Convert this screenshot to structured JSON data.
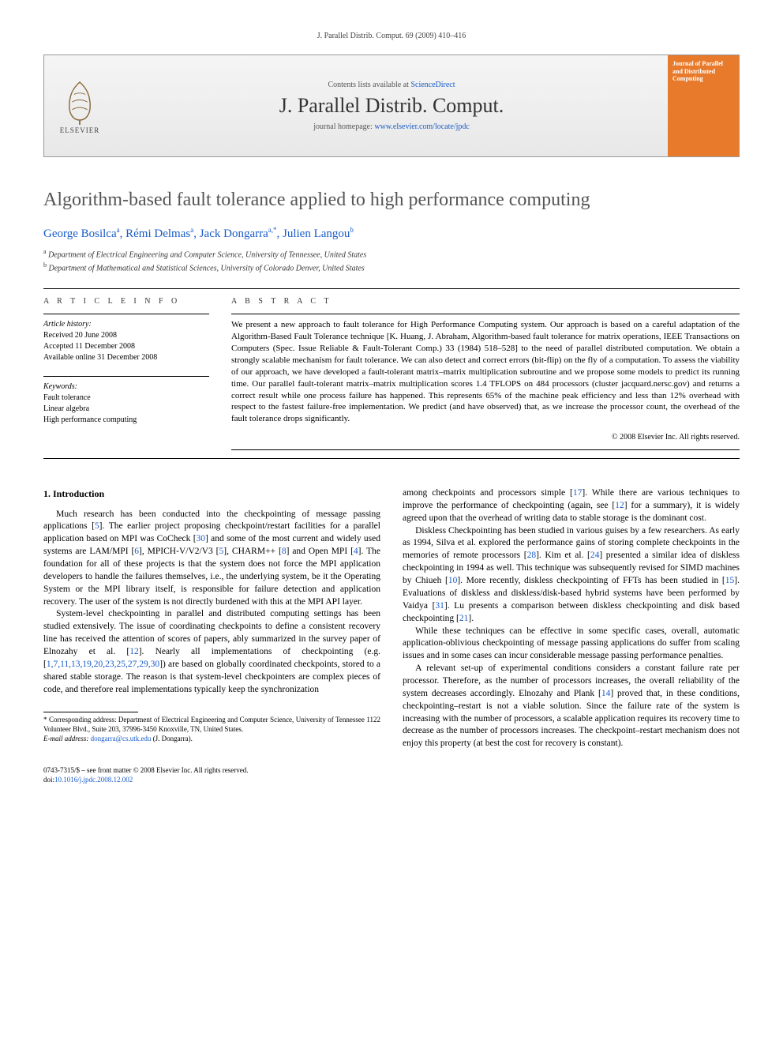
{
  "running_head": "J. Parallel Distrib. Comput. 69 (2009) 410–416",
  "banner": {
    "elsevier_label": "ELSEVIER",
    "contents_prefix": "Contents lists available at ",
    "contents_link": "ScienceDirect",
    "journal_name": "J. Parallel Distrib. Comput.",
    "homepage_prefix": "journal homepage: ",
    "homepage_link": "www.elsevier.com/locate/jpdc",
    "cover_title": "Journal of Parallel and Distributed Computing"
  },
  "title": "Algorithm-based fault tolerance applied to high performance computing",
  "authors": [
    {
      "name": "George Bosilca",
      "mark": "a"
    },
    {
      "name": "Rémi Delmas",
      "mark": "a"
    },
    {
      "name": "Jack Dongarra",
      "mark": "a,*"
    },
    {
      "name": "Julien Langou",
      "mark": "b"
    }
  ],
  "affiliations": [
    {
      "mark": "a",
      "text": "Department of Electrical Engineering and Computer Science, University of Tennessee, United States"
    },
    {
      "mark": "b",
      "text": "Department of Mathematical and Statistical Sciences, University of Colorado Denver, United States"
    }
  ],
  "info": {
    "heading": "A R T I C L E   I N F O",
    "history_label": "Article history:",
    "history": [
      "Received 20 June 2008",
      "Accepted 11 December 2008",
      "Available online 31 December 2008"
    ],
    "keywords_label": "Keywords:",
    "keywords": [
      "Fault tolerance",
      "Linear algebra",
      "High performance computing"
    ]
  },
  "abstract": {
    "heading": "A B S T R A C T",
    "text": "We present a new approach to fault tolerance for High Performance Computing system. Our approach is based on a careful adaptation of the Algorithm-Based Fault Tolerance technique [K. Huang, J. Abraham, Algorithm-based fault tolerance for matrix operations, IEEE Transactions on Computers (Spec. Issue Reliable & Fault-Tolerant Comp.) 33 (1984) 518–528] to the need of parallel distributed computation. We obtain a strongly scalable mechanism for fault tolerance. We can also detect and correct errors (bit-flip) on the fly of a computation. To assess the viability of our approach, we have developed a fault-tolerant matrix–matrix multiplication subroutine and we propose some models to predict its running time. Our parallel fault-tolerant matrix–matrix multiplication scores 1.4 TFLOPS on 484 processors (cluster jacquard.nersc.gov) and returns a correct result while one process failure has happened. This represents 65% of the machine peak efficiency and less than 12% overhead with respect to the fastest failure-free implementation. We predict (and have observed) that, as we increase the processor count, the overhead of the fault tolerance drops significantly.",
    "copyright": "© 2008 Elsevier Inc. All rights reserved."
  },
  "section1": {
    "heading": "1. Introduction",
    "p1a": "Much research has been conducted into the checkpointing of message passing applications [",
    "p1b": "]. The earlier project proposing checkpoint/restart facilities for a parallel application based on MPI was CoCheck [",
    "p1c": "] and some of the most current and widely used systems are LAM/MPI [",
    "p1d": "], MPICH-V/V2/V3 [",
    "p1e": "], CHARM++ [",
    "p1f": "] and Open MPI [",
    "p1g": "]. The foundation for all of these projects is that the system does not force the MPI application developers to handle the failures themselves, i.e., the underlying system, be it the Operating System or the MPI library itself, is responsible for failure detection and application recovery. The user of the system is not directly burdened with this at the MPI API layer.",
    "p2a": "System-level checkpointing in parallel and distributed computing settings has been studied extensively. The issue of coordinating checkpoints to define a consistent recovery line has received the attention of scores of papers, ably summarized in the survey paper of Elnozahy et al. [",
    "p2b": "]. Nearly all implementations of checkpointing (e.g. [",
    "p2c": "]) are based on globally coordinated checkpoints, stored to a shared stable storage. The reason is that system-level checkpointers are complex pieces of code, and therefore real implementations typically keep the synchronization",
    "p3a": "among checkpoints and processors simple [",
    "p3b": "]. While there are various techniques to improve the performance of checkpointing (again, see [",
    "p3c": "] for a summary), it is widely agreed upon that the overhead of writing data to stable storage is the dominant cost.",
    "p4a": "Diskless Checkpointing has been studied in various guises by a few researchers. As early as 1994, Silva et al. explored the performance gains of storing complete checkpoints in the memories of remote processors [",
    "p4b": "]. Kim et al. [",
    "p4c": "] presented a similar idea of diskless checkpointing in 1994 as well. This technique was subsequently revised for SIMD machines by Chiueh [",
    "p4d": "]. More recently, diskless checkpointing of FFTs has been studied in [",
    "p4e": "]. Evaluations of diskless and diskless/disk-based hybrid systems have been performed by Vaidya [",
    "p4f": "]. Lu presents a comparison between diskless checkpointing and disk based checkpointing [",
    "p4g": "].",
    "p5": "While these techniques can be effective in some specific cases, overall, automatic application-oblivious checkpointing of message passing applications do suffer from scaling issues and in some cases can incur considerable message passing performance penalties.",
    "p6a": "A relevant set-up of experimental conditions considers a constant failure rate per processor. Therefore, as the number of processors increases, the overall reliability of the system decreases accordingly. Elnozahy and Plank [",
    "p6b": "] proved that, in these conditions, checkpointing–restart is not a viable solution. Since the failure rate of the system is increasing with the number of processors, a scalable application requires its recovery time to decrease as the number of processors increases. The checkpoint–restart mechanism does not enjoy this property (at best the cost for recovery is constant).",
    "ref_5": "5",
    "ref_30": "30",
    "ref_6": "6",
    "ref_8": "8",
    "ref_4": "4",
    "ref_12": "12",
    "ref_list": "1,7,11,13,19,20,23,25,27,29,30",
    "ref_17": "17",
    "ref_28": "28",
    "ref_24": "24",
    "ref_10": "10",
    "ref_15": "15",
    "ref_31": "31",
    "ref_21": "21",
    "ref_14": "14"
  },
  "footnote": {
    "star": "*",
    "text": " Corresponding address: Department of Electrical Engineering and Computer Science, University of Tennessee 1122 Volunteer Blvd., Suite 203, 37996-3450 Knoxville, TN, United States.",
    "email_label": "E-mail address: ",
    "email": "dongarra@cs.utk.edu",
    "email_who": " (J. Dongarra)."
  },
  "footer": {
    "line1": "0743-7315/$ – see front matter © 2008 Elsevier Inc. All rights reserved.",
    "doi_label": "doi:",
    "doi": "10.1016/j.jpdc.2008.12.002"
  }
}
